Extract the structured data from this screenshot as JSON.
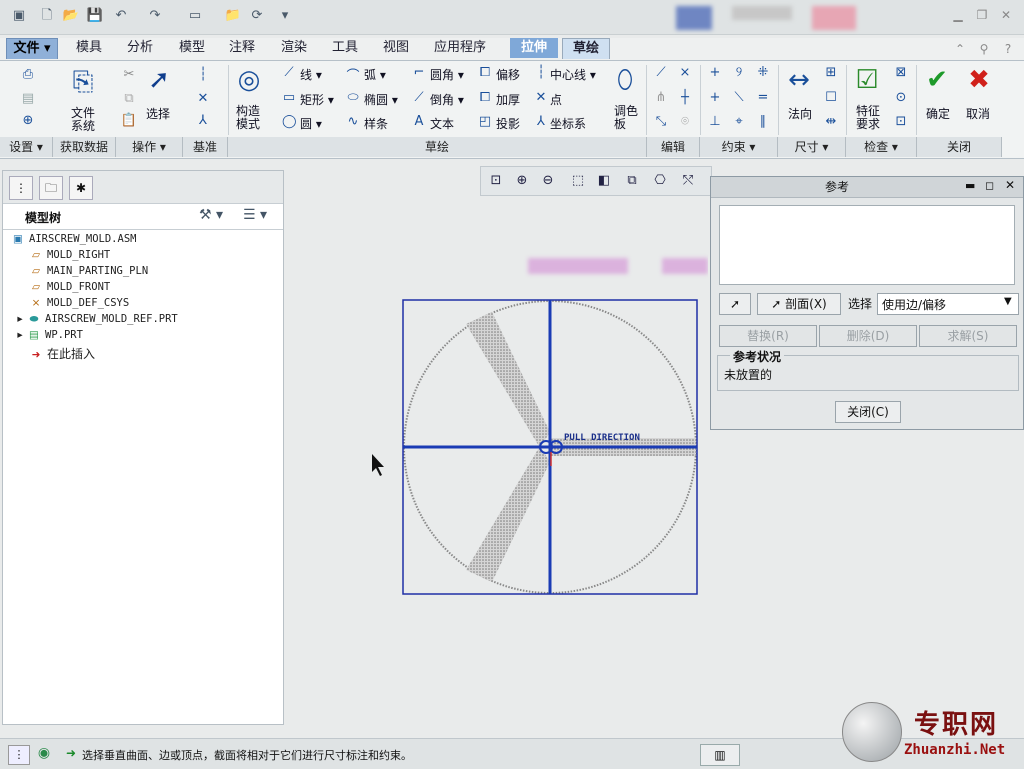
{
  "ribbon_tabs": {
    "file": "文件",
    "mold": "模具",
    "analysis": "分析",
    "model": "模型",
    "annotate": "注释",
    "render": "渲染",
    "tools": "工具",
    "view": "视图",
    "applications": "应用程序",
    "extrude": "拉伸",
    "sketch": "草绘"
  },
  "ribbon": {
    "file_system": "文件\n系统",
    "select": "选择",
    "construction_mode": "构造\n模式",
    "line": "线",
    "arc": "弧",
    "fillet": "圆角",
    "offset": "偏移",
    "centerline": "中心线",
    "rectangle": "矩形",
    "ellipse": "椭圆",
    "chamfer": "倒角",
    "thicken": "加厚",
    "point": "点",
    "circle": "圆",
    "spline": "样条",
    "text": "文本",
    "project": "投影",
    "coordinate_system": "坐标系",
    "palette": "调色\n板",
    "normal": "法向",
    "feature_requirements": "特征\n要求",
    "ok": "确定",
    "cancel": "取消"
  },
  "ribbon_groups": {
    "settings": "设置",
    "get_data": "获取数据",
    "operations": "操作",
    "datum": "基准",
    "sketching": "草绘",
    "editing": "编辑",
    "constrain": "约束",
    "dimension": "尺寸",
    "inspect": "检查",
    "close": "关闭"
  },
  "model_tree": {
    "title": "模型树",
    "items": [
      {
        "label": "AIRSCREW_MOLD.ASM"
      },
      {
        "label": "MOLD_RIGHT"
      },
      {
        "label": "MAIN_PARTING_PLN"
      },
      {
        "label": "MOLD_FRONT"
      },
      {
        "label": "MOLD_DEF_CSYS"
      },
      {
        "label": "AIRSCREW_MOLD_REF.PRT"
      },
      {
        "label": "WP.PRT"
      },
      {
        "label": "在此插入"
      }
    ]
  },
  "graphics": {
    "pull_direction": "PULL DIRECTION"
  },
  "reference_dialog": {
    "title": "参考",
    "section_button": "剖面(X)",
    "select_label": "选择",
    "select_value": "使用边/偏移",
    "replace_button": "替换(R)",
    "delete_button": "删除(D)",
    "solve_button": "求解(S)",
    "status_header": "参考状况",
    "status_value": "未放置的",
    "close_button": "关闭(C)"
  },
  "status_bar": {
    "message": "选择垂直曲面、边或顶点，截面将相对于它们进行尺寸标注和约束。"
  },
  "watermark": {
    "cn": "专职网",
    "url": "Zhuanzhi.Net"
  }
}
